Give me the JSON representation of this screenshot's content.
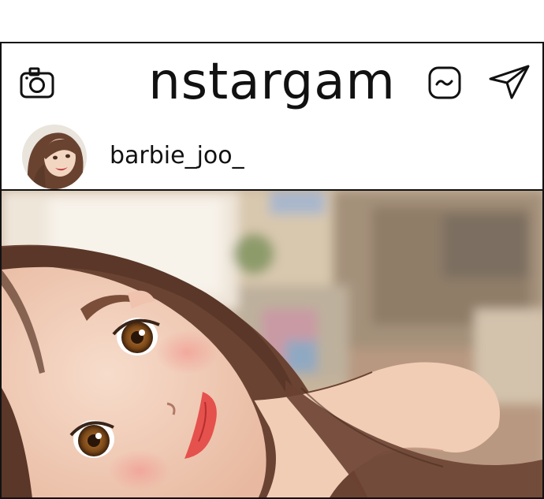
{
  "app": {
    "logo_text": "nstargam"
  },
  "profile": {
    "username": "barbie_joo_"
  },
  "icons": {
    "camera": "camera-icon",
    "dm": "chat-bubble-icon",
    "send": "paper-plane-icon"
  },
  "colors": {
    "frame_border": "#111111",
    "background": "#ffffff"
  }
}
